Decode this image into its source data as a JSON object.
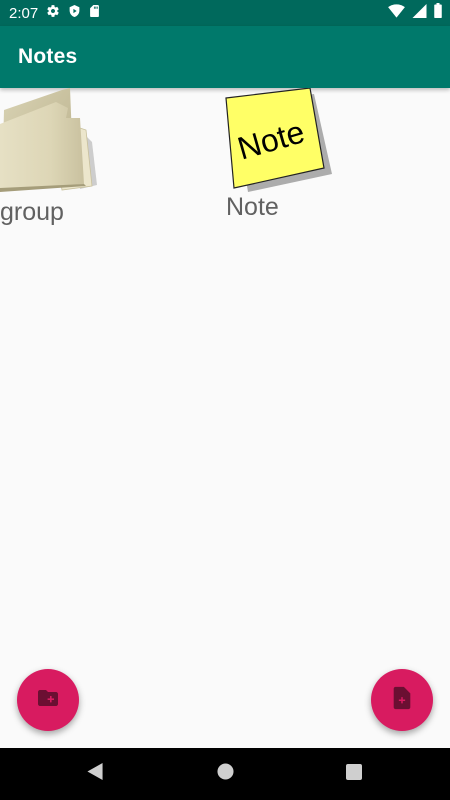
{
  "status_bar": {
    "time": "2:07",
    "icons": [
      "settings-icon",
      "shield-icon",
      "sd-card-icon",
      "wifi-icon",
      "signal-icon",
      "battery-icon"
    ]
  },
  "app_bar": {
    "title": "Notes"
  },
  "items": [
    {
      "label": "group",
      "icon": "folder-icon"
    },
    {
      "label": "Note",
      "icon": "sticky-note-icon",
      "icon_text": "Note"
    }
  ],
  "fabs": [
    {
      "icon": "create-folder-icon"
    },
    {
      "icon": "create-note-icon"
    }
  ],
  "nav_bar": {
    "icons": [
      "back-icon",
      "home-icon",
      "recents-icon"
    ]
  },
  "colors": {
    "status_bar": "#00695c",
    "app_bar": "#00796b",
    "fab": "#d81b60",
    "background": "#fafafa"
  }
}
